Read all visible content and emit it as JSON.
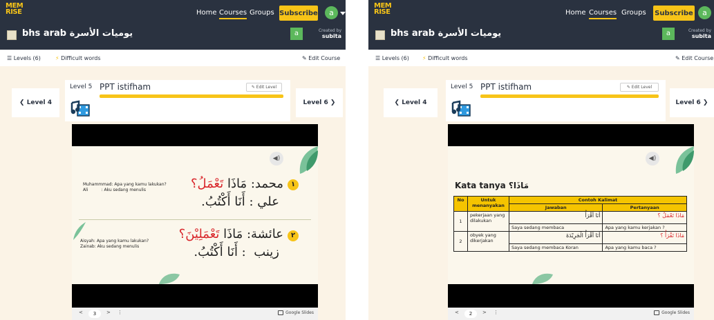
{
  "screens": [
    {
      "logo": "MEM\nRISE",
      "nav": {
        "home": "Home",
        "courses": "Courses",
        "groups": "Groups",
        "subscribe": "Subscribe",
        "avatar": "a"
      },
      "course": {
        "title": "bhs arab يوميات الأسرة",
        "creator_avatar": "a",
        "created_by_label": "Created by",
        "creator": "subita"
      },
      "subnav": {
        "levels": "Levels (6)",
        "difficult": "Difficult words",
        "edit_course": "Edit Course"
      },
      "level": {
        "prev": "Level 4",
        "next": "Level 6",
        "number": "Level 5",
        "name": "PPT istifham",
        "edit": "Edit Level"
      },
      "slide": {
        "items": [
          {
            "num": "١",
            "ar1": "محمد: مَاذَا ",
            "ar1_red": "تَعْمَلُ؟",
            "ar2": "علي : أَنَا أَكْتُبُ.",
            "id1": "Muhammmad: Apa yang kamu lakukan?",
            "id2": "Ali          : Aku sedang menulis"
          },
          {
            "num": "٢",
            "ar1": "عائشة: مَاذَا ",
            "ar1_red": "تَعْمَلِيْنَ؟",
            "ar2": "زينب  : أَنَا أَكْتُبُ.",
            "id1": "Aisyah: Apa yang kamu lakukan?",
            "id2": "Zainab: Aku sedang menulis"
          }
        ]
      },
      "controls": {
        "prev": "<",
        "page": "3",
        "next": ">",
        "more": "⋮",
        "brand": "Google Slides"
      }
    },
    {
      "logo": "MEM\nRISE",
      "nav": {
        "home": "Home",
        "courses": "Courses",
        "groups": "Groups",
        "subscribe": "Subscribe",
        "avatar": "a"
      },
      "course": {
        "title": "bhs arab يوميات الأسرة",
        "creator_avatar": "a",
        "created_by_label": "Created by",
        "creator": "subita"
      },
      "subnav": {
        "levels": "Levels (6)",
        "difficult": "Difficult words",
        "edit_course": "Edit Course"
      },
      "level": {
        "prev": "Level 4",
        "next": "Level 6",
        "number": "Level 5",
        "name": "PPT istifham",
        "edit": "Edit Level"
      },
      "slide": {
        "title": "Kata tanya مَاذَا؟",
        "table": {
          "h_no": "No",
          "h_untuk": "Untuk menanyakan",
          "h_contoh": "Contoh Kalimat",
          "h_jawaban": "Jawaban",
          "h_pertanyaan": "Pertanyaan",
          "rows": [
            {
              "no": "1",
              "untuk": "pekerjaan yang dilakukan",
              "jawaban_ar": "أَنَا أَقْرَأُ",
              "pertanyaan_ar": "مَاذَا تَعْمَلُ ؟",
              "jawaban_id": "Saya sedang membaca",
              "pertanyaan_id": "Apa yang kamu kerjakan ?"
            },
            {
              "no": "2",
              "untuk": "obyek yang dikerjakan",
              "jawaban_ar": "أَنَا أَقْرَأُ الْجَرِيْدَةَ",
              "pertanyaan_ar": "مَاذَا تَقْرَأُ ؟",
              "jawaban_id": "Saya sedang membaca Koran",
              "pertanyaan_id": "Apa yang kamu baca ?"
            }
          ]
        }
      },
      "controls": {
        "prev": "<",
        "page": "2",
        "next": ">",
        "more": "⋮",
        "brand": "Google Slides"
      }
    }
  ],
  "colors": {
    "topbar": "#2a3240",
    "accent": "#f7c418",
    "page_bg": "#fbf3e6",
    "avatar": "#5cb85c",
    "highlight_red": "#d9252a"
  },
  "icons": [
    "chevron-left-icon",
    "chevron-right-icon",
    "list-icon",
    "lightning-icon",
    "pencil-icon",
    "film-music-icon",
    "speaker-icon",
    "dropdown-caret-icon",
    "google-slides-icon",
    "more-vertical-icon"
  ]
}
